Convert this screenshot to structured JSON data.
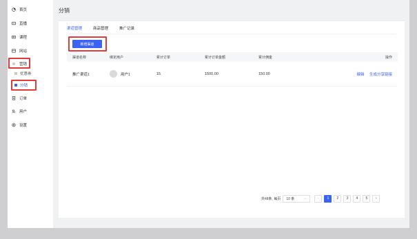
{
  "sidebar": {
    "items": [
      {
        "label": "首页",
        "icon": "dashboard-icon"
      },
      {
        "label": "直播",
        "icon": "live-icon"
      },
      {
        "label": "课程",
        "icon": "course-icon"
      },
      {
        "label": "网站",
        "icon": "website-icon"
      },
      {
        "label": "营销",
        "icon": "marketing-icon"
      },
      {
        "label": "订单",
        "icon": "order-icon"
      },
      {
        "label": "用户",
        "icon": "user-icon"
      },
      {
        "label": "设置",
        "icon": "settings-icon"
      }
    ],
    "sub_items": [
      {
        "label": "优惠券"
      },
      {
        "label": "分销"
      }
    ]
  },
  "header": {
    "title": "分销"
  },
  "tabs": [
    {
      "label": "渠道管理"
    },
    {
      "label": "商品管理"
    },
    {
      "label": "推广记录"
    }
  ],
  "actions": {
    "add_channel": "新增渠道"
  },
  "table": {
    "columns": [
      "渠道名称",
      "绑定用户",
      "累计订单",
      "累计订单金额",
      "累计佣金",
      "操作"
    ],
    "rows": [
      {
        "name": "推广渠道1",
        "user": "用户1",
        "orders": "15",
        "amount": "1500.00",
        "commission": "150.00",
        "edit": "编辑",
        "share": "生成分享链接"
      }
    ]
  },
  "pagination": {
    "summary": "共48条, 每页",
    "page_size": "10 条",
    "prev": "‹",
    "next": "›",
    "pages": [
      "1",
      "2",
      "3",
      "4",
      "5"
    ]
  },
  "colors": {
    "accent": "#3a63f3",
    "highlight": "#e23a3a"
  }
}
